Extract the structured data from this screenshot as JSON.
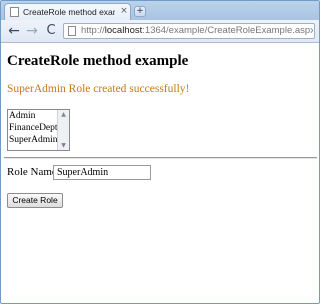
{
  "browser": {
    "tab_title": "CreateRole method exampl…",
    "tab_close": "×",
    "new_tab": "+",
    "back_glyph": "←",
    "forward_glyph": "→",
    "reload_glyph": "C",
    "url_scheme": "http://",
    "url_host": "localhost",
    "url_rest": ":1364/example/CreateRoleExample.aspx"
  },
  "page": {
    "heading": "CreateRole method example",
    "message": "SuperAdmin Role created successfully!",
    "roles": [
      "Admin",
      "FinanceDept",
      "SuperAdmin"
    ],
    "role_name_label": "Role Name",
    "role_name_value": "SuperAdmin",
    "create_button_label": "Create Role"
  },
  "colors": {
    "message": "#c87a16",
    "frame_border": "#6f9bc5"
  }
}
